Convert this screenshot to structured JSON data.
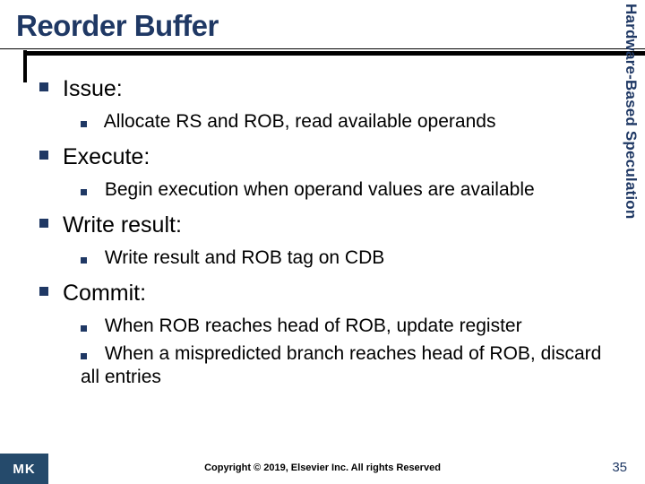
{
  "title": "Reorder Buffer",
  "sidebar": "Hardware-Based Speculation",
  "sections": [
    {
      "heading": "Issue:",
      "items": [
        "Allocate RS and ROB, read available operands"
      ]
    },
    {
      "heading": "Execute:",
      "items": [
        "Begin execution when operand values are available"
      ]
    },
    {
      "heading": "Write result:",
      "items": [
        "Write result and ROB tag on CDB"
      ]
    },
    {
      "heading": "Commit:",
      "items": [
        "When ROB reaches head of ROB, update register",
        "When a mispredicted branch reaches head of ROB, discard all entries"
      ]
    }
  ],
  "footer": {
    "logo": "MK",
    "copyright": "Copyright © 2019, Elsevier Inc. All rights Reserved",
    "page": "35"
  }
}
